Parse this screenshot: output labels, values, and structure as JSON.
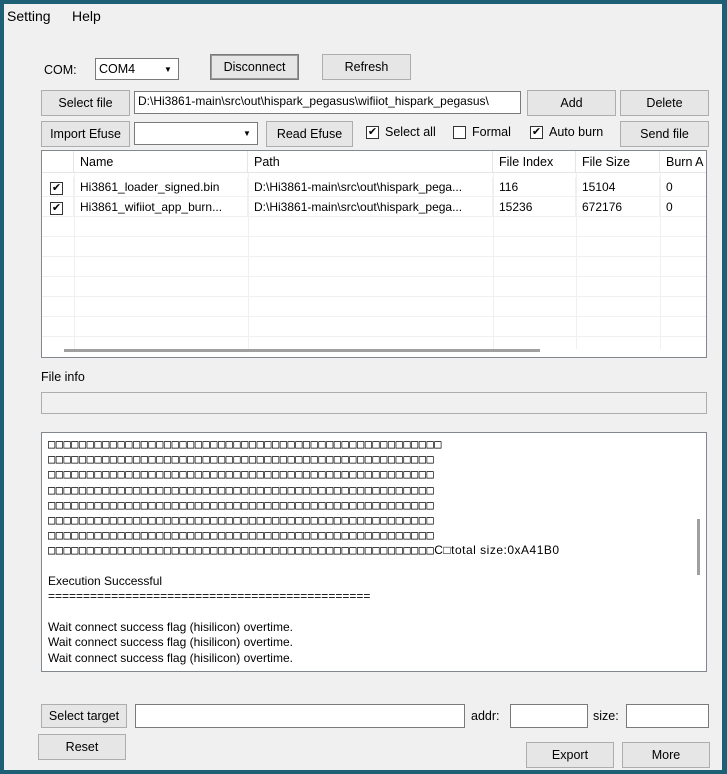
{
  "menu": [
    "Setting",
    "Help"
  ],
  "com": {
    "label": "COM:",
    "selected": "COM4",
    "disconnect_label": "Disconnect",
    "refresh_label": "Refresh"
  },
  "file_bar": {
    "select_file_label": "Select file",
    "path_value": "D:\\Hi3861-main\\src\\out\\hispark_pegasus\\wifiiot_hispark_pegasus\\",
    "add_label": "Add",
    "delete_label": "Delete"
  },
  "efuse_bar": {
    "import_efuse_label": "Import Efuse",
    "efuse_combo_value": "",
    "read_efuse_label": "Read Efuse",
    "select_all_label": "Select all",
    "select_all_checked": true,
    "formal_label": "Formal",
    "formal_checked": false,
    "auto_burn_label": "Auto burn",
    "auto_burn_checked": true,
    "send_file_label": "Send file"
  },
  "table": {
    "columns": [
      "Name",
      "Path",
      "File Index",
      "File Size",
      "Burn A"
    ],
    "rows": [
      {
        "checked": true,
        "name": "Hi3861_loader_signed.bin",
        "path": "D:\\Hi3861-main\\src\\out\\hispark_pega...",
        "index": "116",
        "size": "15104",
        "burn": "0"
      },
      {
        "checked": true,
        "name": "Hi3861_wifiiot_app_burn...",
        "path": "D:\\Hi3861-main\\src\\out\\hispark_pega...",
        "index": "15236",
        "size": "672176",
        "burn": "0"
      }
    ]
  },
  "file_info": {
    "label": "File info",
    "value": ""
  },
  "log": {
    "square_lines": [
      "□□□□□□□□□□□□□□□□□□□□□□□□□□□□□□□□□□□□□□□□□□□□□□□□□□□",
      "□□□□□□□□□□□□□□□□□□□□□□□□□□□□□□□□□□□□□□□□□□□□□□□□□□",
      "□□□□□□□□□□□□□□□□□□□□□□□□□□□□□□□□□□□□□□□□□□□□□□□□□□",
      "□□□□□□□□□□□□□□□□□□□□□□□□□□□□□□□□□□□□□□□□□□□□□□□□□□",
      "□□□□□□□□□□□□□□□□□□□□□□□□□□□□□□□□□□□□□□□□□□□□□□□□□□",
      "□□□□□□□□□□□□□□□□□□□□□□□□□□□□□□□□□□□□□□□□□□□□□□□□□□",
      "□□□□□□□□□□□□□□□□□□□□□□□□□□□□□□□□□□□□□□□□□□□□□□□□□□",
      "□□□□□□□□□□□□□□□□□□□□□□□□□□□□□□□□□□□□□□□□□□□□□□□□□□"
    ],
    "last_square_suffix": "C□total size:0xA41B0",
    "blank1": "",
    "success": "Execution Successful",
    "separator": "==============================================",
    "blank2": "",
    "wait1": "Wait connect success flag (hisilicon) overtime.",
    "wait2": "Wait connect success flag (hisilicon) overtime.",
    "wait3": "Wait connect success flag (hisilicon) overtime."
  },
  "bottom": {
    "select_target_label": "Select target",
    "target_value": "",
    "addr_label": "addr:",
    "addr_value": "",
    "size_label": "size:",
    "size_value": "",
    "reset_label": "Reset",
    "export_label": "Export",
    "more_label": "More"
  }
}
